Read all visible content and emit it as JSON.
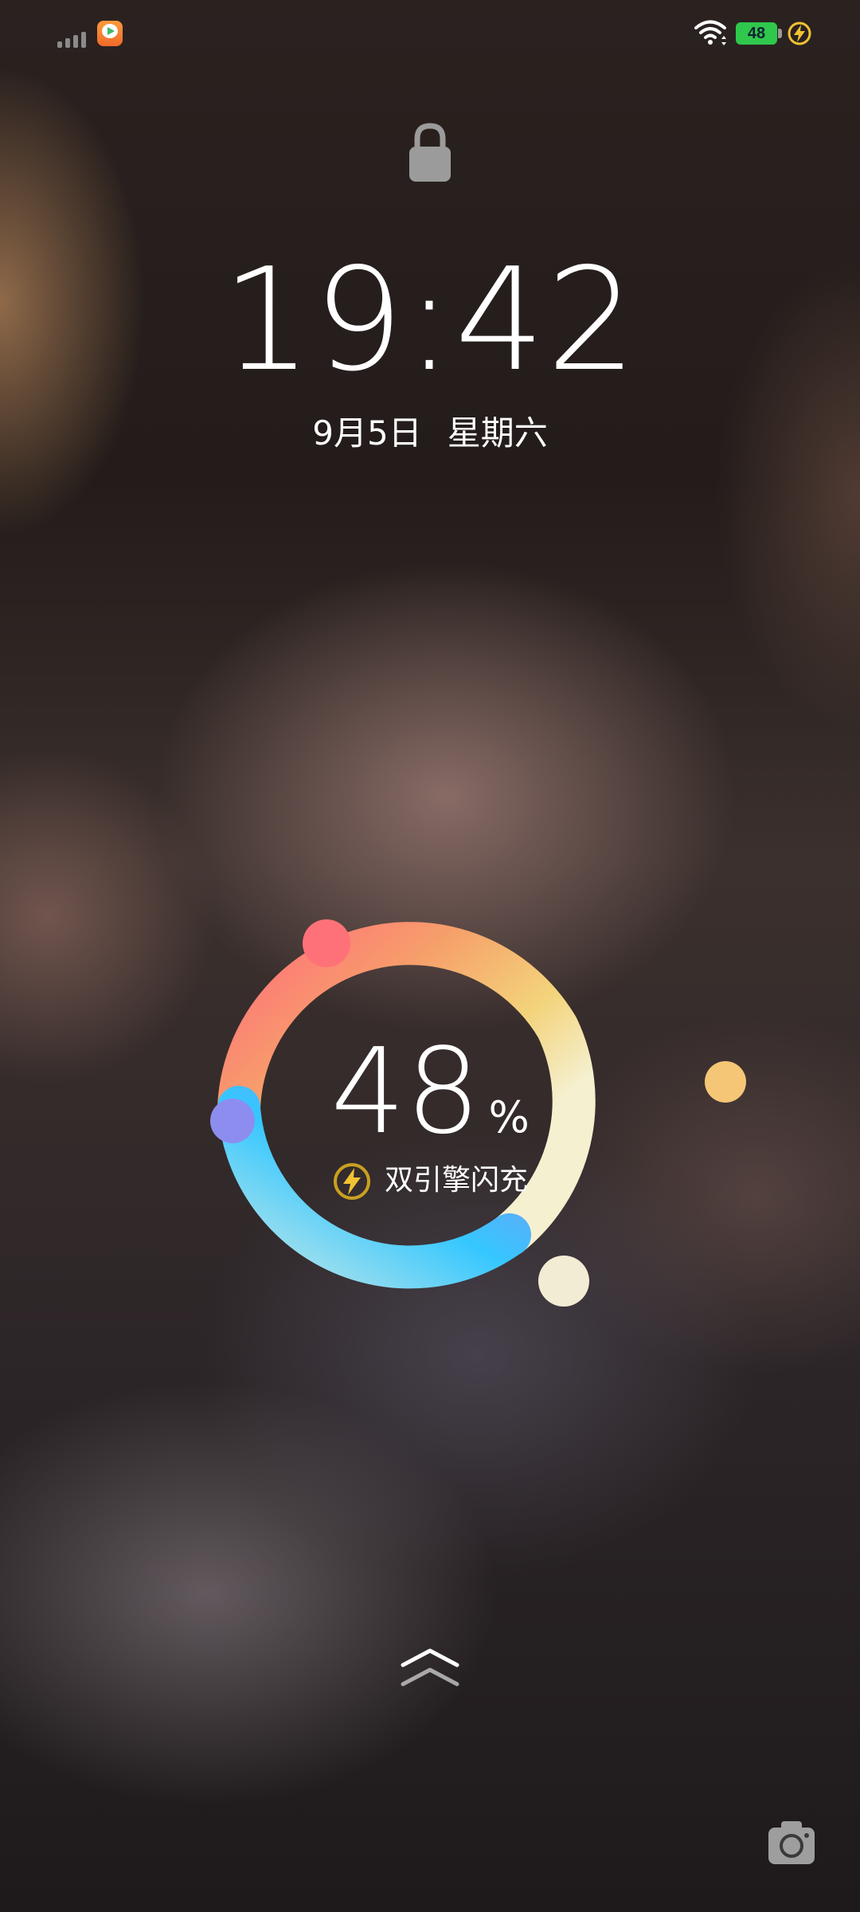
{
  "status_bar": {
    "battery_level": "48",
    "icons": [
      "signal-icon",
      "video-app-icon",
      "wifi-icon",
      "battery-icon",
      "fast-charge-icon"
    ]
  },
  "lockscreen": {
    "time": "19:42",
    "date": "9月5日",
    "weekday": "星期六"
  },
  "charging": {
    "percent": "48",
    "percent_sign": "%",
    "mode_label": "双引擎闪充",
    "level_fraction": 0.48
  },
  "colors": {
    "ring_red": "#ff6f7a",
    "ring_orange": "#f6a06a",
    "ring_yellow": "#f3d37a",
    "ring_blue": "#35c7ff",
    "ring_purple": "#8d8df0",
    "battery_green": "#2fc84c",
    "bolt_yellow": "#f1c232"
  },
  "bottom": {
    "icons": [
      "swipe-up-icon",
      "camera-icon"
    ]
  }
}
